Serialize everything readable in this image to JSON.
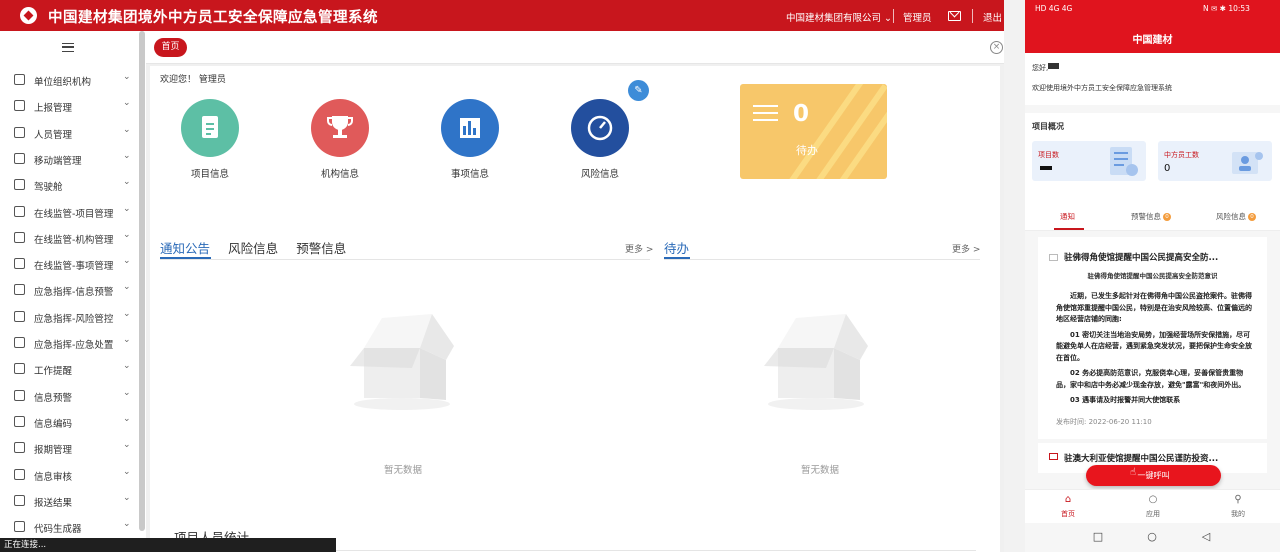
{
  "desktop": {
    "system_title": "中国建材集团境外中方员工安全保障应急管理系统",
    "company": "中国建材集团有限公司",
    "user": "管理员",
    "logout": "退出",
    "menu": [
      {
        "label": "单位组织机构",
        "icon": "org-tree-icon"
      },
      {
        "label": "上报管理",
        "icon": "grid-icon"
      },
      {
        "label": "人员管理",
        "icon": "person-icon"
      },
      {
        "label": "移动端管理",
        "icon": "mobile-icon"
      },
      {
        "label": "驾驶舱",
        "icon": "gear-icon"
      },
      {
        "label": "在线监管-项目管理",
        "icon": "folder-search-icon"
      },
      {
        "label": "在线监管-机构管理",
        "icon": "org-tree-icon"
      },
      {
        "label": "在线监管-事项管理",
        "icon": "book-icon"
      },
      {
        "label": "应急指挥-信息预警",
        "icon": "star-icon"
      },
      {
        "label": "应急指挥-风险管控",
        "icon": "monitor-icon"
      },
      {
        "label": "应急指挥-应急处置",
        "icon": "screen-icon"
      },
      {
        "label": "工作提醒",
        "icon": "headset-icon"
      },
      {
        "label": "信息预警",
        "icon": "document-icon"
      },
      {
        "label": "信息编码",
        "icon": "document-icon"
      },
      {
        "label": "报期管理",
        "icon": "list-icon"
      },
      {
        "label": "信息审核",
        "icon": "list-icon"
      },
      {
        "label": "报送结果",
        "icon": "list-icon"
      },
      {
        "label": "代码生成器",
        "icon": "edit-icon"
      }
    ],
    "tab_home": "首页",
    "welcome": "欢迎您！ 管理员",
    "quick_links": [
      {
        "label": "项目信息",
        "color": "#5dbfa5",
        "icon": "document-icon"
      },
      {
        "label": "机构信息",
        "color": "#e05a5a",
        "icon": "trophy-icon"
      },
      {
        "label": "事项信息",
        "color": "#2f74c8",
        "icon": "chart-icon"
      },
      {
        "label": "风险信息",
        "color": "#234f9e",
        "icon": "gauge-icon"
      }
    ],
    "todo_card": {
      "count": "0",
      "label": "待办"
    },
    "left_tabs": [
      "通知公告",
      "风险信息",
      "预警信息"
    ],
    "right_tabs": [
      "待办"
    ],
    "more": "更多 >",
    "empty_text": "暂无数据",
    "stats_title": "项目人员统计",
    "status_toast": "正在连接..."
  },
  "phone": {
    "status_left": "HD 4G 4G",
    "status_right": "N ✉ ✱ 10:53",
    "title": "中国建材",
    "hello": "您好,",
    "welcome": "欢迎使用境外中方员工安全保障应急管理系统",
    "overview_title": "项目概况",
    "cards": [
      {
        "label": "项目数",
        "value": ""
      },
      {
        "label": "中方员工数",
        "value": "0"
      }
    ],
    "tabs": [
      {
        "label": "通知",
        "badge": ""
      },
      {
        "label": "预警信息",
        "badge": "0"
      },
      {
        "label": "风险信息",
        "badge": "0"
      }
    ],
    "notice": {
      "title": "驻佛得角使馆提醒中国公民提高安全防...",
      "subtitle": "驻佛得角使馆提醒中国公民提高安全防范意识",
      "para1": "近期，已发生多起针对在佛得角中国公民盗抢案件。驻佛得角使馆郑重提醒中国公民，特别是在治安风险较高、位置偏远的地区经营店铺的同胞:",
      "para2": "01 密切关注当地治安局势，加强经营场所安保措施，尽可能避免单人在店经营，遇到紧急突发状况，要把保护生命安全放在首位。",
      "para3": "02 务必提高防范意识，克服侥幸心理，妥善保管贵重物品，家中和店中务必减少现金存放，避免\"露富\"和夜间外出。",
      "para4": "03 遇事请及时报警并同大使馆联系",
      "time": "发布时间:   2022-06-20 11:10"
    },
    "notice2_title": "驻澳大利亚使馆提醒中国公民谨防投资...",
    "call_button": "一键呼叫",
    "nav": [
      {
        "label": "首页",
        "icon": "home-icon"
      },
      {
        "label": "应用",
        "icon": "chat-icon"
      },
      {
        "label": "我的",
        "icon": "search-icon"
      }
    ]
  }
}
